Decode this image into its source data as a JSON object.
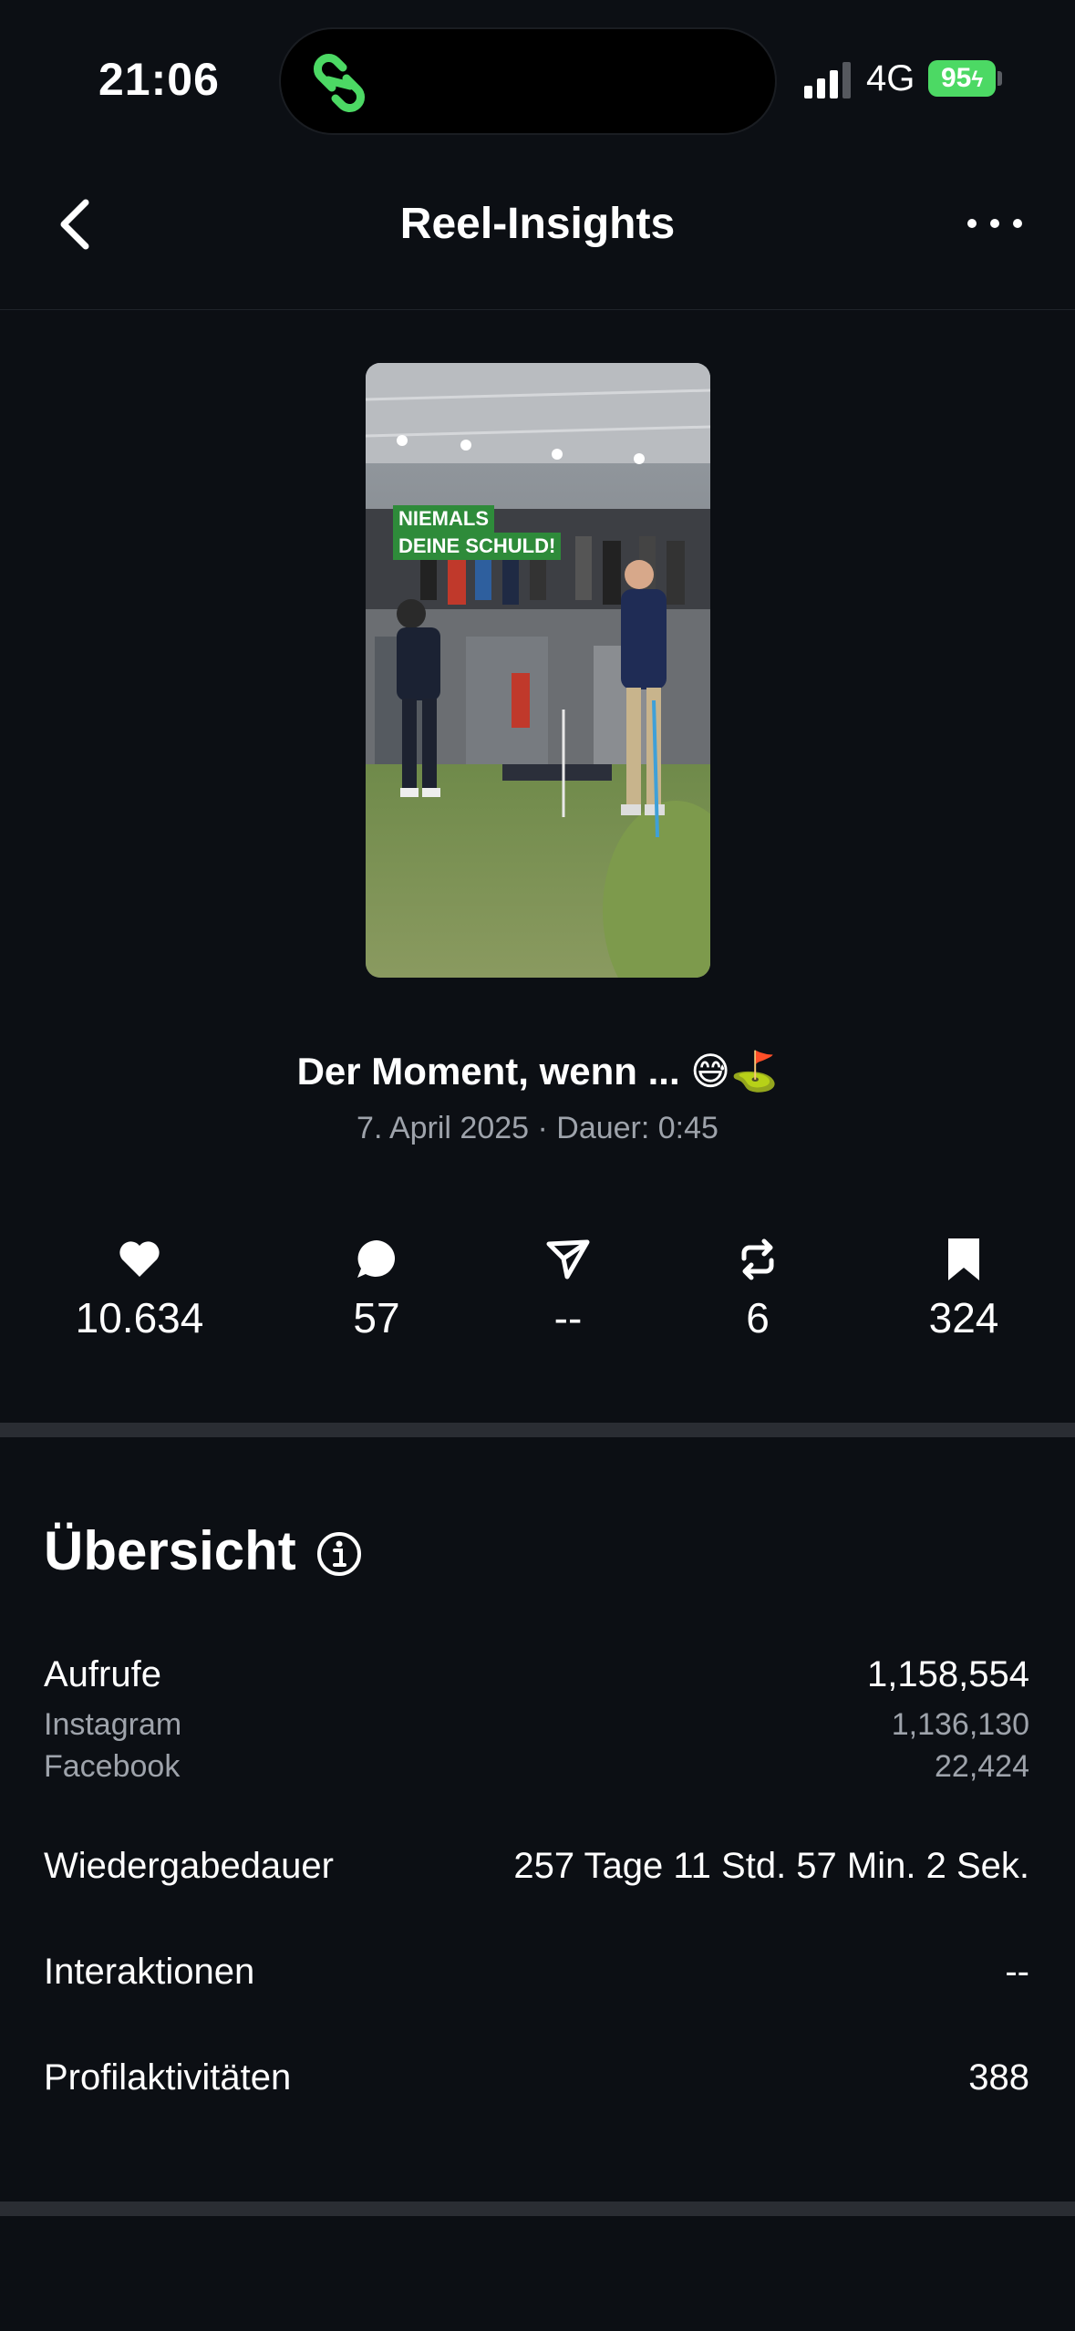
{
  "status_bar": {
    "time": "21:06",
    "network": "4G",
    "battery": "95"
  },
  "nav": {
    "title": "Reel-Insights"
  },
  "reel": {
    "overlay_line1": "NIEMALS",
    "overlay_line2": "DEINE SCHULD!",
    "caption": "Der Moment, wenn ... 😅⛳",
    "meta": "7. April 2025 · Dauer: 0:45"
  },
  "stats": {
    "likes": "10.634",
    "comments": "57",
    "shares": "--",
    "reposts": "6",
    "saves": "324"
  },
  "overview": {
    "title": "Übersicht",
    "views_label": "Aufrufe",
    "views_value": "1,158,554",
    "instagram_label": "Instagram",
    "instagram_value": "1,136,130",
    "facebook_label": "Facebook",
    "facebook_value": "22,424",
    "watch_time_label": "Wiedergabedauer",
    "watch_time_value": "257 Tage 11 Std. 57 Min. 2 Sek.",
    "interactions_label": "Interaktionen",
    "interactions_value": "--",
    "profile_label": "Profilaktivitäten",
    "profile_value": "388"
  },
  "colors": {
    "background": "#0c0f14",
    "secondary_text": "#9ea3ab",
    "battery": "#4cd964",
    "island_icon": "#4cd964"
  }
}
